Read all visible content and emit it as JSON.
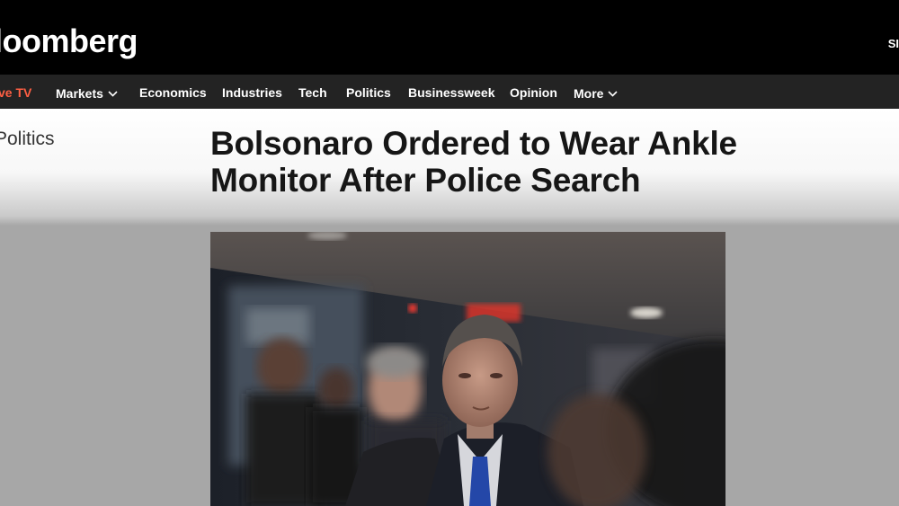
{
  "nav": {
    "items": [
      {
        "label": "ve TV"
      },
      {
        "label": "Markets"
      },
      {
        "label": "Economics"
      },
      {
        "label": "Industries"
      },
      {
        "label": "Tech"
      },
      {
        "label": "Politics"
      },
      {
        "label": "Businessweek"
      },
      {
        "label": "Opinion"
      },
      {
        "label": "More"
      }
    ]
  },
  "masthead": {
    "logo": "loomberg",
    "corner": "SI"
  },
  "article": {
    "section": "Politics",
    "headline": "Bolsonaro Ordered to Wear Ankle Monitor After Police Search"
  },
  "colors": {
    "masthead_bg": "#000000",
    "nav_bg": "#232323",
    "live_accent": "#ff5f43",
    "page_bg": "#a7a7a7"
  },
  "icons": {
    "markets_dropdown": "chevron-down-icon",
    "more_dropdown": "chevron-down-icon"
  }
}
